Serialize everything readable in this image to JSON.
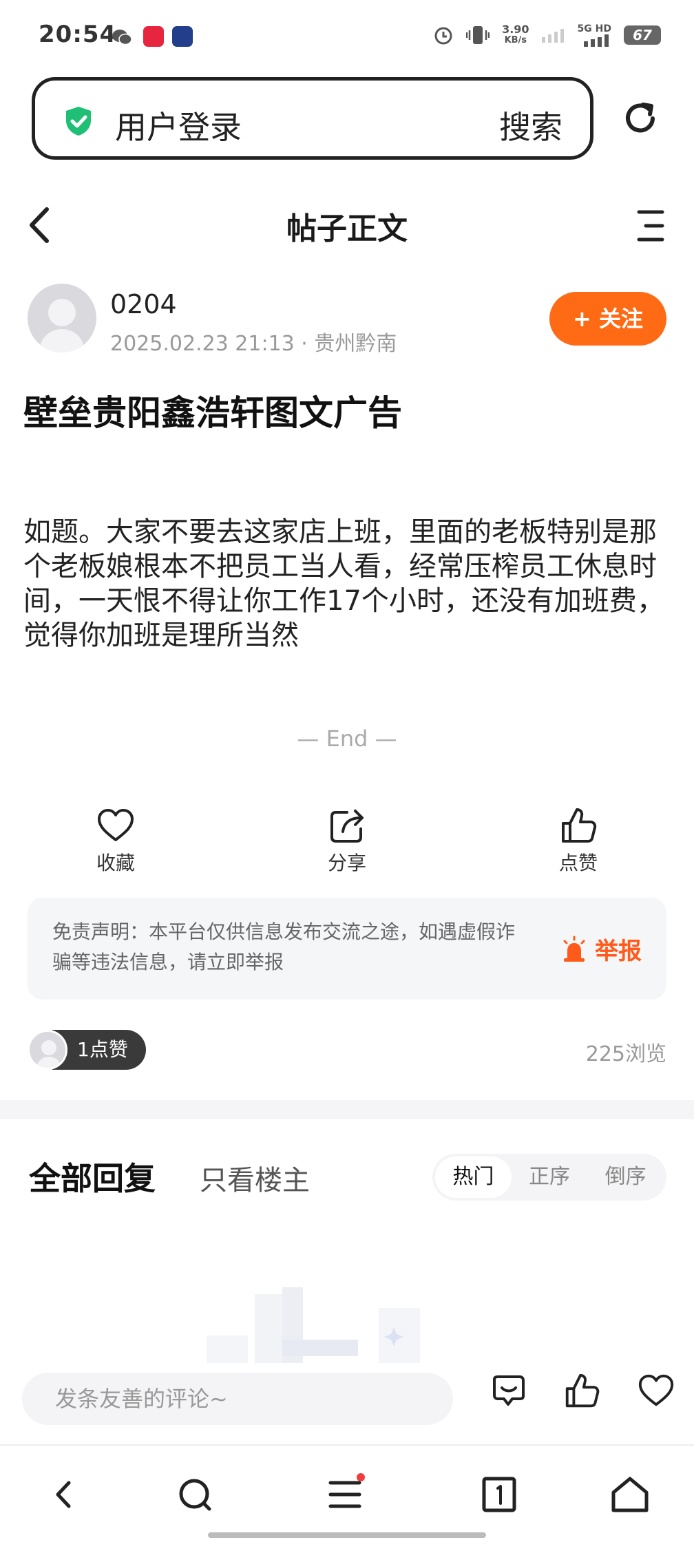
{
  "status_bar": {
    "time": "20:54",
    "speed_value": "3.90",
    "speed_unit": "KB/s",
    "network": "5G HD",
    "battery": "67"
  },
  "search": {
    "text": "用户登录",
    "button": "搜索"
  },
  "header": {
    "title": "帖子正文"
  },
  "author": {
    "name": "0204",
    "meta": "2025.02.23 21:13 · 贵州黔南",
    "follow_label": "+ 关注"
  },
  "post": {
    "title": "壁垒贵阳鑫浩轩图文广告",
    "body": "如题。大家不要去这家店上班，里面的老板特别是那个老板娘根本不把员工当人看，经常压榨员工休息时间，一天恨不得让你工作17个小时，还没有加班费，觉得你加班是理所当然",
    "end_text": "— End —"
  },
  "actions": [
    {
      "label": "收藏",
      "icon": "heart-icon"
    },
    {
      "label": "分享",
      "icon": "share-icon"
    },
    {
      "label": "点赞",
      "icon": "thumbs-up-icon"
    }
  ],
  "disclaimer": {
    "text": "免责声明：本平台仅供信息发布交流之途，如遇虚假诈骗等违法信息，请立即举报",
    "report_label": "举报"
  },
  "stats": {
    "likes": "1点赞",
    "views": "225浏览"
  },
  "replies": {
    "tab_all": "全部回复",
    "tab_op": "只看楼主",
    "sort_options": [
      "热门",
      "正序",
      "倒序"
    ],
    "active_sort": "热门"
  },
  "comment": {
    "placeholder": "发条友善的评论~"
  },
  "colors": {
    "accent": "#ff6a14",
    "report": "#ff5a1a",
    "shield": "#1fbf75"
  }
}
